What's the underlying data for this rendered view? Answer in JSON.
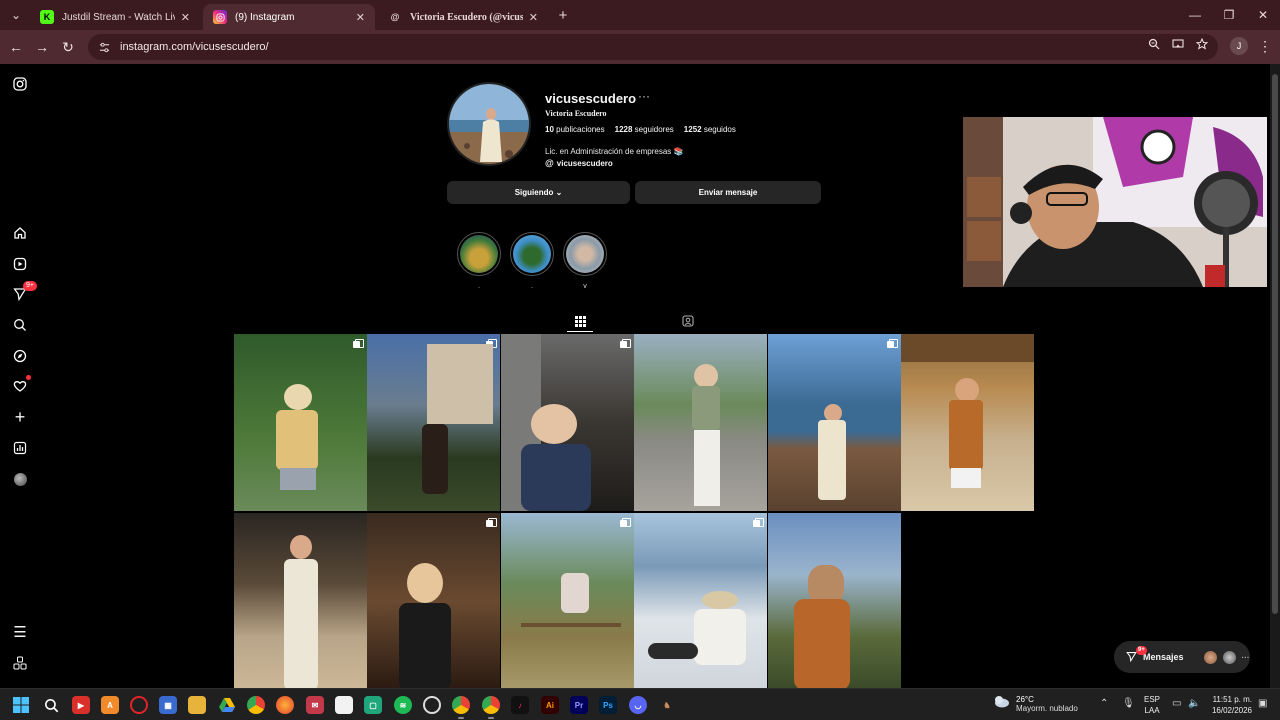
{
  "browser": {
    "tabs": [
      {
        "title": "Justdil Stream - Watch Live on Kick",
        "favicon": "K",
        "active": false
      },
      {
        "title": "(9) Instagram",
        "favicon": "ig",
        "active": true
      },
      {
        "title": "Victoria Escudero (@vicusescudero)",
        "favicon": "threads",
        "active": false
      }
    ],
    "url": "instagram.com/vicusescudero/",
    "profile_initial": "J"
  },
  "profile": {
    "username": "vicusescudero",
    "more_glyph": "···",
    "full_name": "Victoria Escudero",
    "stats": {
      "posts_count": "10",
      "posts_label": "publicaciones",
      "followers_count": "1228",
      "followers_label": "seguidores",
      "following_count": "1252",
      "following_label": "seguidos"
    },
    "bio": "Lic. en Administración de empresas 📚",
    "threads_handle": "vicusescudero",
    "following_button": "Siguiendo ⌄",
    "message_button": "Enviar mensaje",
    "highlights": [
      {
        "label": "."
      },
      {
        "label": "."
      },
      {
        "label": "v"
      }
    ]
  },
  "messages_pill": {
    "label": "Mensajes",
    "badge": "9+",
    "more": "···"
  },
  "nav_badge": "9+",
  "taskbar": {
    "weather_temp": "26°C",
    "weather_desc": "Mayorm. nublado",
    "lang_top": "ESP",
    "lang_bottom": "LAA",
    "time": "11:51 p. m.",
    "date": "16/02/2026"
  },
  "colors": {
    "chrome": "#3b1b1f",
    "toolbar": "#4f2b31",
    "page_bg": "#000000",
    "button_bg": "#262626",
    "notification": "#ff3040"
  }
}
